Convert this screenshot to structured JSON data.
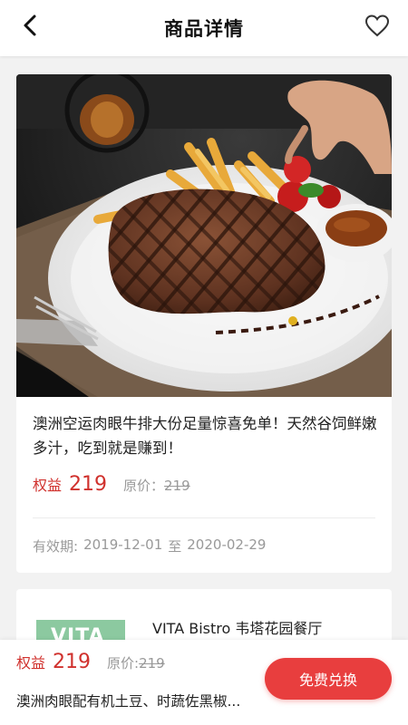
{
  "header": {
    "title": "商品详情",
    "back_icon": "chevron-left-icon",
    "favorite_icon": "heart-outline-icon"
  },
  "product": {
    "image": "grilled-steak-photo",
    "description": "澳洲空运肉眼牛排大份足量惊喜免单！天然谷饲鲜嫩多汁，吃到就是赚到！",
    "benefit_label": "权益",
    "benefit_value": "219",
    "original_label": "原价：",
    "original_value": "219",
    "validity_label": "有效期:",
    "validity_start": "2019-12-01",
    "validity_sep": "至",
    "validity_end": "2020-02-29"
  },
  "shop": {
    "logo_text": "VITA",
    "name": "VITA Bistro  韦塔花园餐厅"
  },
  "bottom_bar": {
    "benefit_label": "权益",
    "benefit_value": "219",
    "original_label": "原价:",
    "original_value": "219",
    "summary": "澳洲肉眼配有机土豆、时蔬佐黑椒...",
    "redeem_label": "免费兑换"
  },
  "colors": {
    "accent": "#d0312d",
    "button": "#e83e3e",
    "muted": "#999999"
  }
}
